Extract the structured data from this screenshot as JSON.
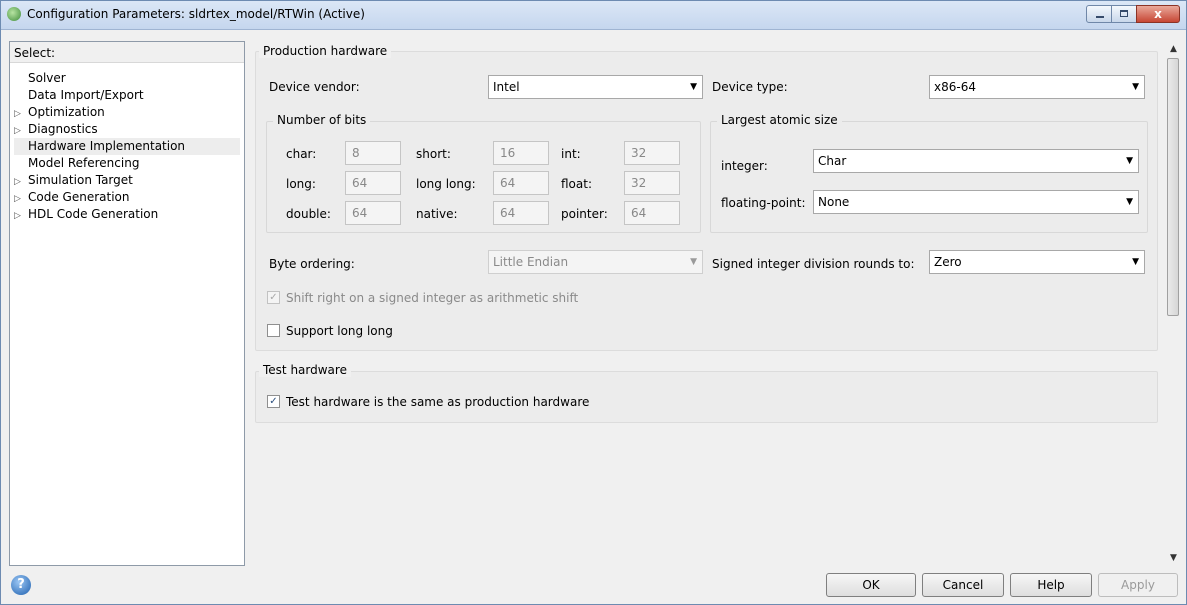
{
  "window": {
    "title": "Configuration Parameters: sldrtex_model/RTWin (Active)",
    "close_label": "x"
  },
  "tree": {
    "header": "Select:",
    "items": [
      {
        "label": "Solver",
        "expandable": false
      },
      {
        "label": "Data Import/Export",
        "expandable": false
      },
      {
        "label": "Optimization",
        "expandable": true
      },
      {
        "label": "Diagnostics",
        "expandable": true
      },
      {
        "label": "Hardware Implementation",
        "expandable": false,
        "selected": true
      },
      {
        "label": "Model Referencing",
        "expandable": false
      },
      {
        "label": "Simulation Target",
        "expandable": true
      },
      {
        "label": "Code Generation",
        "expandable": true
      },
      {
        "label": "HDL Code Generation",
        "expandable": true
      }
    ]
  },
  "production": {
    "title": "Production hardware",
    "device_vendor_label": "Device vendor:",
    "device_vendor_value": "Intel",
    "device_type_label": "Device type:",
    "device_type_value": "x86-64",
    "bits_title": "Number of bits",
    "bits": {
      "char_label": "char:",
      "char_value": "8",
      "short_label": "short:",
      "short_value": "16",
      "int_label": "int:",
      "int_value": "32",
      "long_label": "long:",
      "long_value": "64",
      "longlong_label": "long long:",
      "longlong_value": "64",
      "float_label": "float:",
      "float_value": "32",
      "double_label": "double:",
      "double_value": "64",
      "native_label": "native:",
      "native_value": "64",
      "pointer_label": "pointer:",
      "pointer_value": "64"
    },
    "atomic_title": "Largest atomic size",
    "integer_label": "integer:",
    "integer_value": "Char",
    "floating_label": "floating-point:",
    "floating_value": "None",
    "byte_ordering_label": "Byte ordering:",
    "byte_ordering_value": "Little Endian",
    "division_label": "Signed integer division rounds to:",
    "division_value": "Zero",
    "shift_right_label": "Shift right on a signed integer as arithmetic shift",
    "shift_right_checked": true,
    "support_longlong_label": "Support long long",
    "support_longlong_checked": false
  },
  "test": {
    "title": "Test hardware",
    "same_label": "Test hardware is the same as production hardware",
    "same_checked": true
  },
  "buttons": {
    "ok": "OK",
    "cancel": "Cancel",
    "help": "Help",
    "apply": "Apply"
  },
  "glyphs": {
    "check": "✓",
    "dropdown": "▼",
    "tree_arrow": "▷",
    "scroll_up": "▲",
    "scroll_down": "▼",
    "help": "?"
  }
}
